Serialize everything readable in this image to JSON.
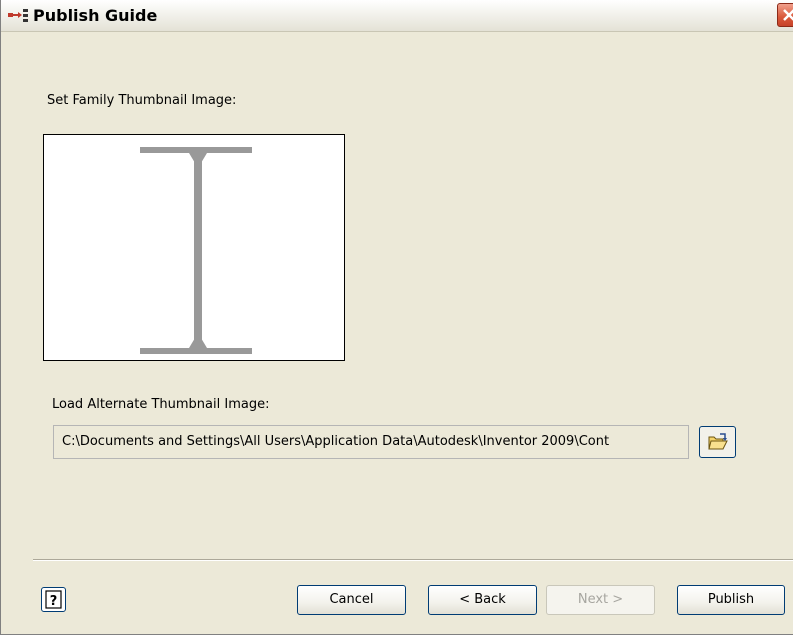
{
  "window": {
    "title": "Publish Guide"
  },
  "thumbnail_section": {
    "label": "Set Family Thumbnail Image:"
  },
  "alternate_section": {
    "label": "Load Alternate Thumbnail Image:",
    "path_value": "C:\\Documents and Settings\\All Users\\Application Data\\Autodesk\\Inventor 2009\\Cont"
  },
  "buttons": {
    "cancel": "Cancel",
    "back": "< Back",
    "next": "Next >",
    "publish": "Publish"
  },
  "icons": {
    "title": "publish-guide-icon",
    "close": "close-icon",
    "browse": "open-folder-icon",
    "help": "help-icon"
  },
  "colors": {
    "dialog_background": "#ece9d8",
    "close_button": "#d9583a",
    "beam_gray": "#999999"
  }
}
